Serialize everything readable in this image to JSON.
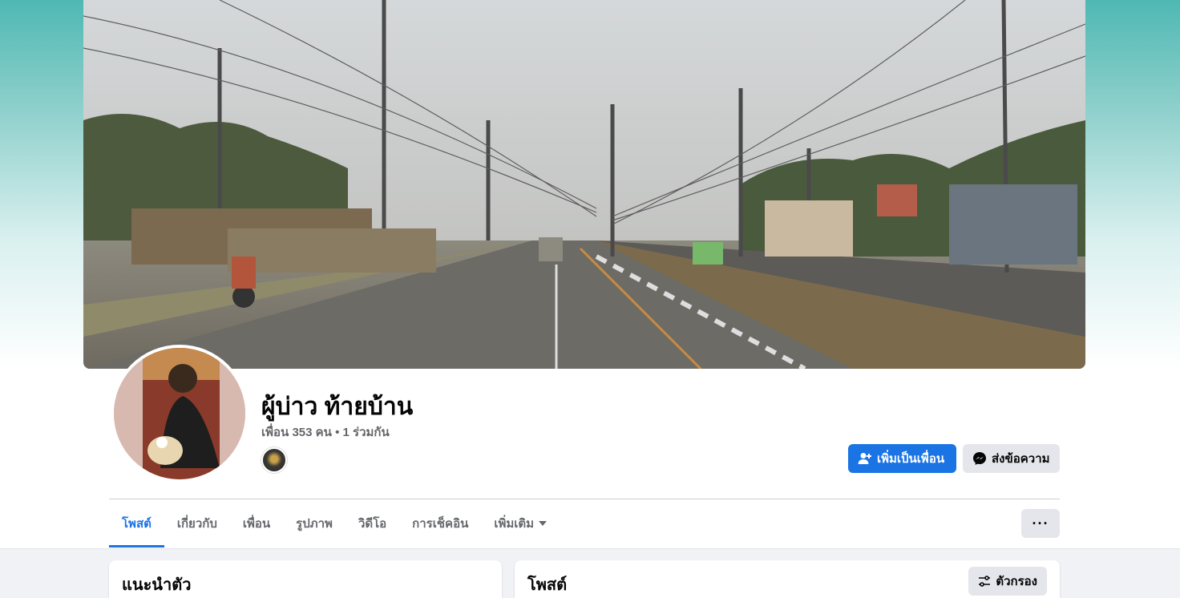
{
  "profile": {
    "name": "ผู้บ่าว ท้ายบ้าน",
    "friends_summary": "เพื่อน 353 คน • 1 ร่วมกัน"
  },
  "actions": {
    "add_friend_label": "เพิ่มเป็นเพื่อน",
    "message_label": "ส่งข้อความ"
  },
  "tabs": [
    {
      "label": "โพสต์",
      "active": true
    },
    {
      "label": "เกี่ยวกับ",
      "active": false
    },
    {
      "label": "เพื่อน",
      "active": false
    },
    {
      "label": "รูปภาพ",
      "active": false
    },
    {
      "label": "วิดีโอ",
      "active": false
    },
    {
      "label": "การเช็คอิน",
      "active": false
    },
    {
      "label": "เพิ่มเติม",
      "active": false
    }
  ],
  "more_menu_label": "···",
  "intro_card": {
    "title": "แนะนำตัว"
  },
  "posts_card": {
    "title": "โพสต์",
    "filter_label": "ตัวกรอง"
  },
  "colors": {
    "accent": "#1b74e4",
    "secondary_button": "#e4e6eb",
    "page_bg": "#f0f2f5"
  },
  "icons": [
    "add-friend-icon",
    "messenger-icon",
    "caret-down-icon",
    "more-dots-icon",
    "filter-icon"
  ]
}
